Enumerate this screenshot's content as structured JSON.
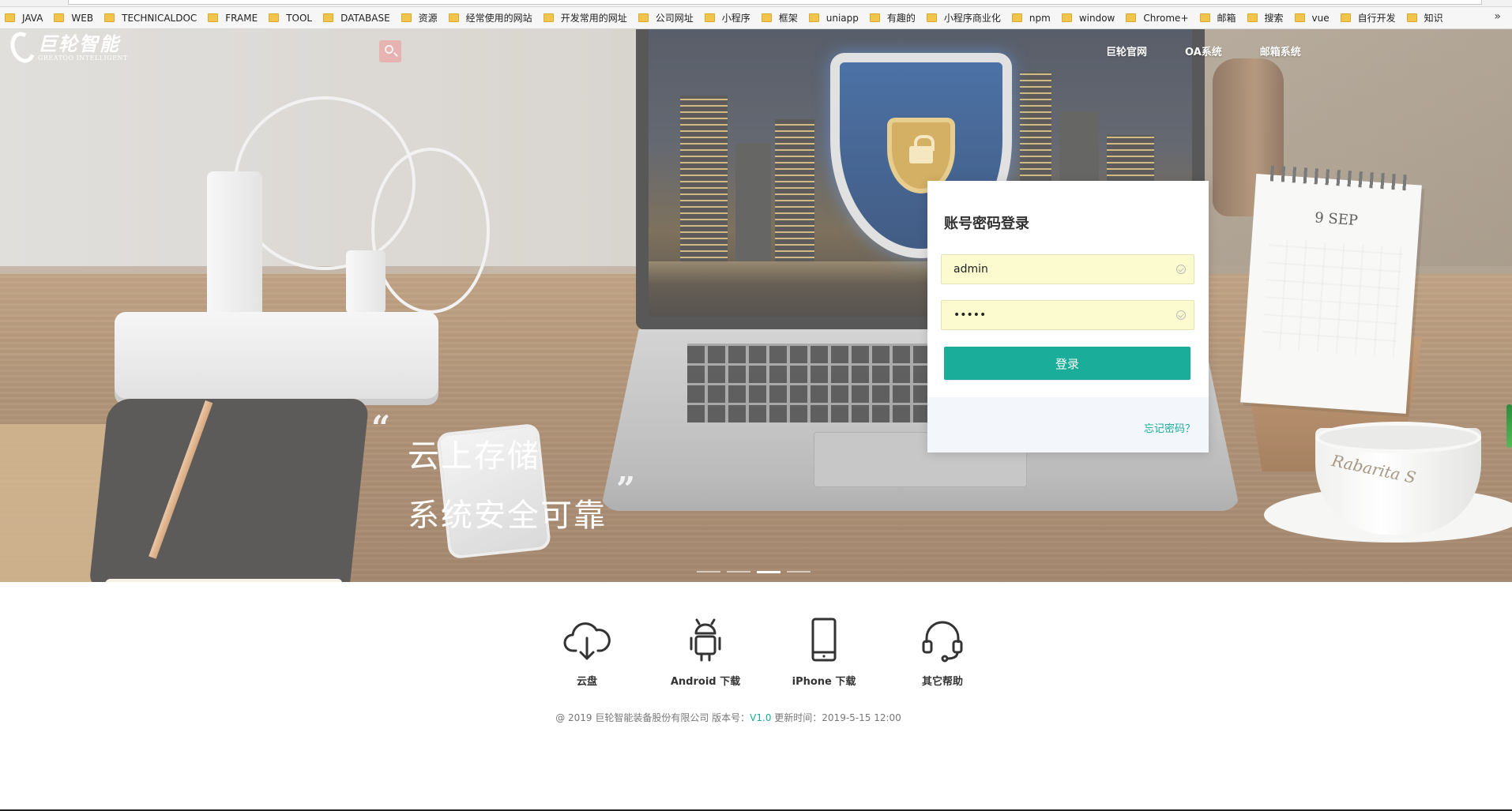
{
  "bookmarks": [
    {
      "label": "JAVA"
    },
    {
      "label": "WEB"
    },
    {
      "label": "TECHNICALDOC"
    },
    {
      "label": "FRAME"
    },
    {
      "label": "TOOL"
    },
    {
      "label": "DATABASE"
    },
    {
      "label": "资源"
    },
    {
      "label": "经常使用的网站"
    },
    {
      "label": "开发常用的网址"
    },
    {
      "label": "公司网址"
    },
    {
      "label": "小程序"
    },
    {
      "label": "框架"
    },
    {
      "label": "uniapp"
    },
    {
      "label": "有趣的"
    },
    {
      "label": "小程序商业化"
    },
    {
      "label": "npm"
    },
    {
      "label": "window"
    },
    {
      "label": "Chrome+"
    },
    {
      "label": "邮箱"
    },
    {
      "label": "搜索"
    },
    {
      "label": "vue"
    },
    {
      "label": "自行开发"
    },
    {
      "label": "知识"
    }
  ],
  "bookmarks_more": "»",
  "logo": {
    "cn": "巨轮智能",
    "en": "GREATOO INTELLIGENT"
  },
  "nav": [
    {
      "label": "巨轮官网"
    },
    {
      "label": "OA系统"
    },
    {
      "label": "邮箱系统"
    }
  ],
  "hero": {
    "quote_open": "“",
    "quote_close": "”",
    "slogan_line1": "云上存储",
    "slogan_line2": "系统安全可靠",
    "calendar_title": "9 SEP",
    "cup_text": "Rabarita S",
    "slides_total": 4,
    "slides_active": 3
  },
  "login": {
    "title": "账号密码登录",
    "username_value": "admin",
    "password_value": "•••••",
    "submit_label": "登录",
    "forgot_label": "忘记密码？"
  },
  "tools": [
    {
      "label": "云盘",
      "icon": "cloud-download-icon"
    },
    {
      "label": "Android 下载",
      "icon": "android-icon"
    },
    {
      "label": "iPhone 下载",
      "icon": "phone-icon"
    },
    {
      "label": "其它帮助",
      "icon": "headset-icon"
    }
  ],
  "footer": {
    "copyright_prefix": "@ 2019 巨轮智能装备股份有限公司 版本号：",
    "version": "V1.0",
    "update_text": " 更新时间：2019-5-15 12:00"
  },
  "colors": {
    "accent": "#1aad9a",
    "field_bg": "#fbfbcf"
  }
}
